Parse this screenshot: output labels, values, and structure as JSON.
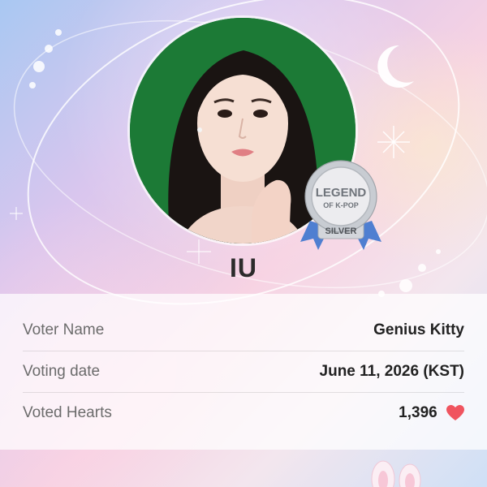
{
  "profile": {
    "artist_name": "IU",
    "badge": {
      "line1": "LEGEND",
      "line2": "OF K-POP",
      "tier": "SILVER"
    }
  },
  "info": {
    "rows": [
      {
        "label": "Voter Name",
        "value": "Genius Kitty"
      },
      {
        "label": "Voting date",
        "value": "June 11, 2026 (KST)"
      },
      {
        "label": "Voted Hearts",
        "value": "1,396"
      }
    ]
  },
  "icons": {
    "heart": "heart-icon",
    "moon": "moon-icon",
    "sparkle": "sparkle-icon"
  },
  "colors": {
    "heart": "#f0545f",
    "avatar_bg": "#1c7a36",
    "badge_ribbon": "#4f7fd1"
  }
}
